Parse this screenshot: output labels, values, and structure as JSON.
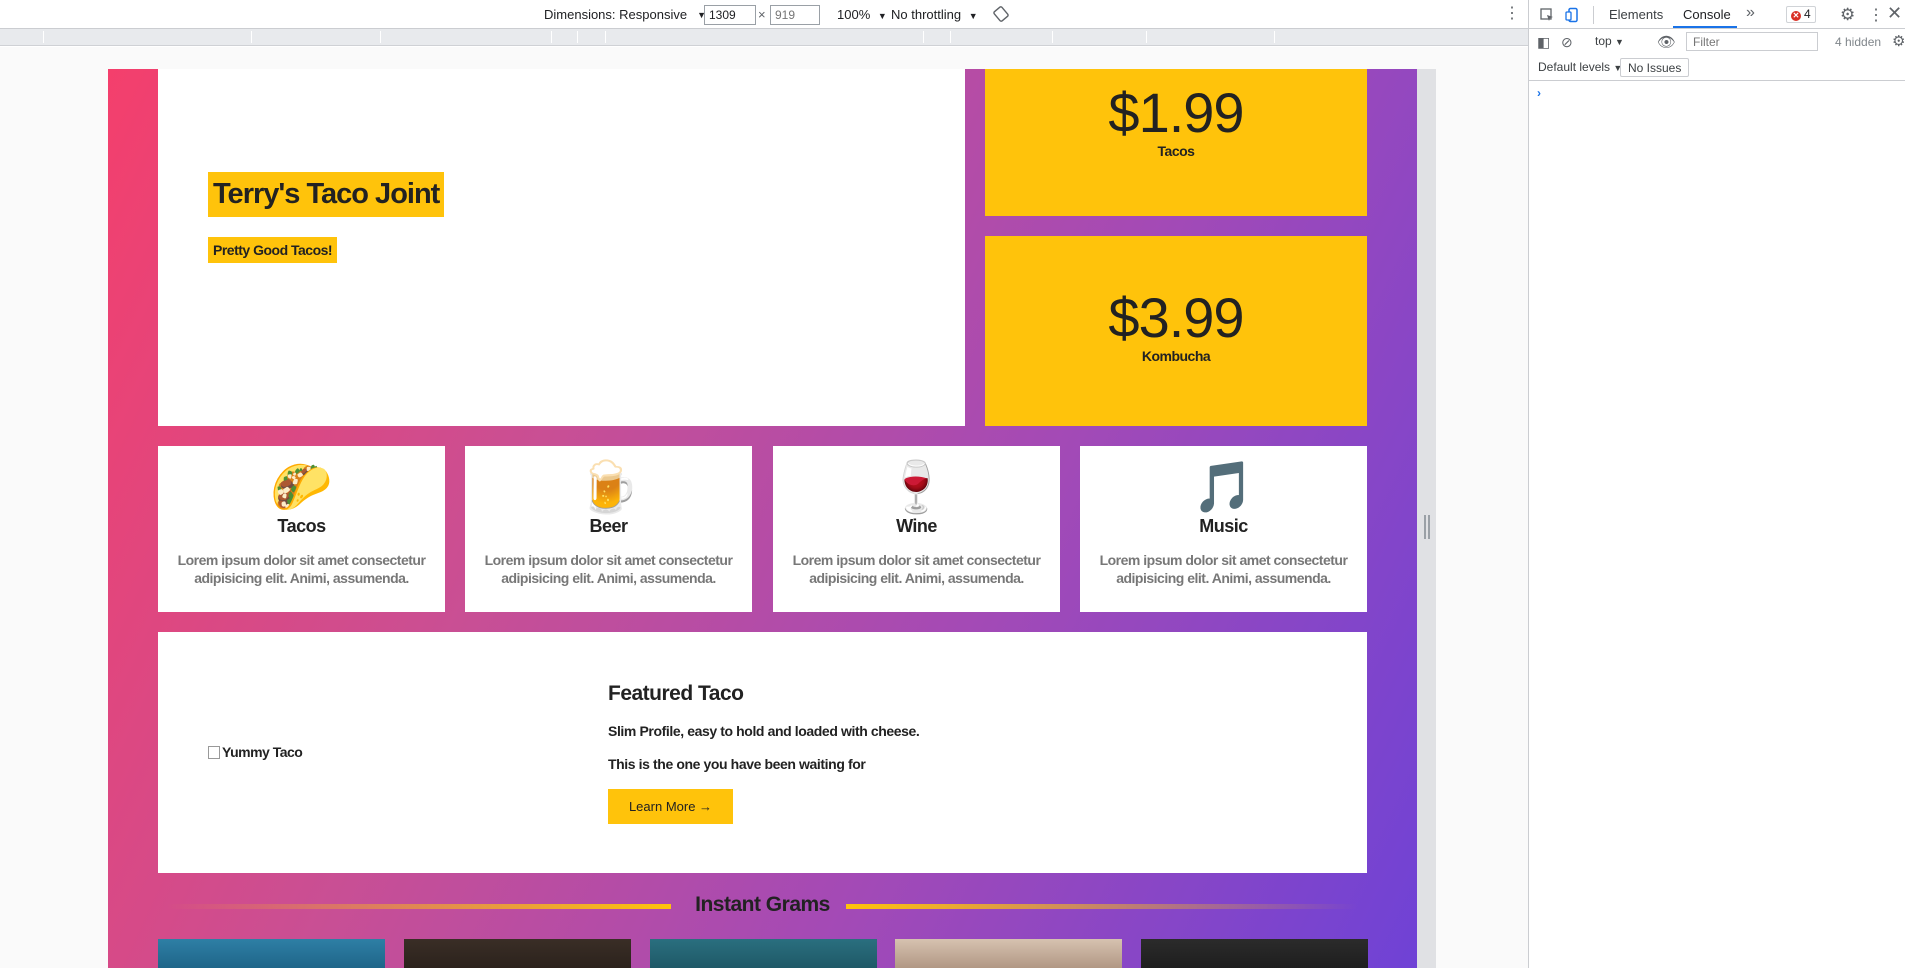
{
  "toolbar": {
    "dimensions_label": "Dimensions: Responsive",
    "width_value": "1309",
    "height_placeholder": "919",
    "times": "×",
    "zoom": "100%",
    "throttling": "No throttling"
  },
  "site": {
    "title": "Terry's Taco Joint",
    "subtitle": "Pretty Good Tacos!",
    "prices": [
      {
        "amount": "$1.99",
        "label": "Tacos"
      },
      {
        "amount": "$3.99",
        "label": "Kombucha"
      }
    ],
    "features": [
      {
        "emoji": "🌮",
        "icon": "taco-icon",
        "title": "Tacos",
        "desc": "Lorem ipsum dolor sit amet consectetur adipisicing elit. Animi, assumenda."
      },
      {
        "emoji": "🍺",
        "icon": "beer-icon",
        "title": "Beer",
        "desc": "Lorem ipsum dolor sit amet consectetur adipisicing elit. Animi, assumenda."
      },
      {
        "emoji": "🍷",
        "icon": "wine-icon",
        "title": "Wine",
        "desc": "Lorem ipsum dolor sit amet consectetur adipisicing elit. Animi, assumenda."
      },
      {
        "emoji": "🎵",
        "icon": "music-icon",
        "title": "Music",
        "desc": "Lorem ipsum dolor sit amet consectetur adipisicing elit. Animi, assumenda."
      }
    ],
    "featured": {
      "img_alt": "Yummy Taco",
      "title": "Featured Taco",
      "line1": "Slim Profile, easy to hold and loaded with cheese.",
      "line2": "This is the one you have been waiting for",
      "button": "Learn More →"
    },
    "grams_title": "Instant Grams",
    "colors": {
      "accent": "#ffc30b",
      "gradient_start": "#f43f6c",
      "gradient_end": "#6e42d6"
    }
  },
  "devtools": {
    "tabs": [
      "Elements",
      "Console"
    ],
    "active_tab": "Console",
    "error_count": "4",
    "context": "top",
    "filter_placeholder": "Filter",
    "hidden_count": "4 hidden",
    "levels": "Default levels",
    "issues": "No Issues",
    "prompt": "›"
  }
}
